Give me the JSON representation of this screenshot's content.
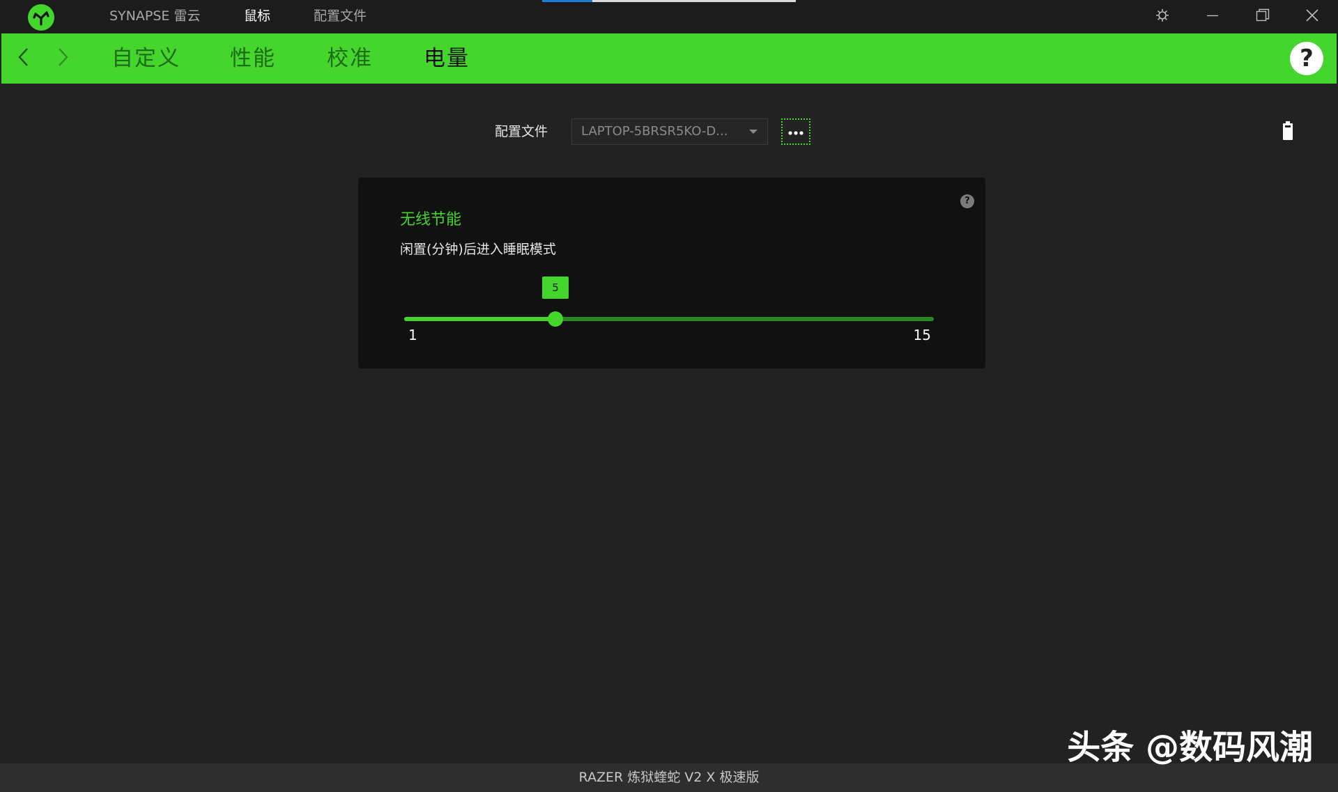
{
  "titlebar": {
    "tabs": [
      {
        "label": "SYNAPSE 雷云",
        "active": false
      },
      {
        "label": "鼠标",
        "active": true
      },
      {
        "label": "配置文件",
        "active": false
      }
    ]
  },
  "navbar": {
    "tabs": [
      {
        "label": "自定义",
        "active": false
      },
      {
        "label": "性能",
        "active": false
      },
      {
        "label": "校准",
        "active": false
      },
      {
        "label": "电量",
        "active": true
      }
    ],
    "help_glyph": "?"
  },
  "profile": {
    "label": "配置文件",
    "selected": "LAPTOP-5BRSR5KO-D...",
    "more_glyph": "•••"
  },
  "power_saving": {
    "title": "无线节能",
    "description": "闲置(分钟)后进入睡眠模式",
    "help_glyph": "?",
    "slider": {
      "min": 1,
      "max": 15,
      "value": 5
    }
  },
  "footer": {
    "device_name": "RAZER 炼狱蝰蛇 V2 X 极速版"
  },
  "watermark": {
    "text": "头条 @数码风潮"
  },
  "colors": {
    "accent": "#44d62c",
    "background": "#222222",
    "panel": "#111111",
    "titlebar": "#1c1c1c",
    "footer": "#2e2e2e"
  },
  "icons": {
    "logo": "razer-logo-icon",
    "settings": "gear-icon",
    "minimize": "minimize-icon",
    "maximize": "restore-icon",
    "close": "close-icon",
    "back": "chevron-left-icon",
    "forward": "chevron-right-icon",
    "battery": "battery-icon"
  }
}
